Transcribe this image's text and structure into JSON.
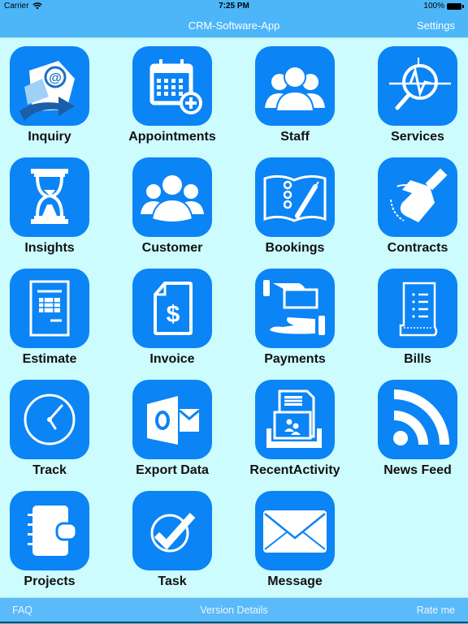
{
  "status_bar": {
    "carrier": "Carrier",
    "time": "7:25 PM",
    "battery": "100%"
  },
  "nav": {
    "title": "CRM-Software-App",
    "settings_label": "Settings"
  },
  "colors": {
    "accent": "#0b84f5",
    "bar": "#4cb6f9",
    "background": "#cdfcff"
  },
  "tiles": [
    {
      "label": "Inquiry",
      "icon": "email-at-icon"
    },
    {
      "label": "Appointments",
      "icon": "calendar-add-icon"
    },
    {
      "label": "Staff",
      "icon": "people-group-icon"
    },
    {
      "label": "Services",
      "icon": "search-pulse-icon"
    },
    {
      "label": "Insights",
      "icon": "hourglass-icon"
    },
    {
      "label": "Customer",
      "icon": "customers-icon"
    },
    {
      "label": "Bookings",
      "icon": "book-pen-icon"
    },
    {
      "label": "Contracts",
      "icon": "handshake-icon"
    },
    {
      "label": "Estimate",
      "icon": "document-table-icon"
    },
    {
      "label": "Invoice",
      "icon": "invoice-dollar-icon"
    },
    {
      "label": "Payments",
      "icon": "hand-payment-icon"
    },
    {
      "label": "Bills",
      "icon": "receipt-icon"
    },
    {
      "label": "Track",
      "icon": "clock-icon"
    },
    {
      "label": "Export Data",
      "icon": "outlook-icon"
    },
    {
      "label": "RecentActivity",
      "icon": "recent-activity-icon"
    },
    {
      "label": "News Feed",
      "icon": "rss-icon"
    },
    {
      "label": "Projects",
      "icon": "planner-icon"
    },
    {
      "label": "Task",
      "icon": "check-circle-icon"
    },
    {
      "label": "Message",
      "icon": "envelope-icon"
    }
  ],
  "footer": {
    "faq": "FAQ",
    "version": "Version Details",
    "rate": "Rate me"
  }
}
